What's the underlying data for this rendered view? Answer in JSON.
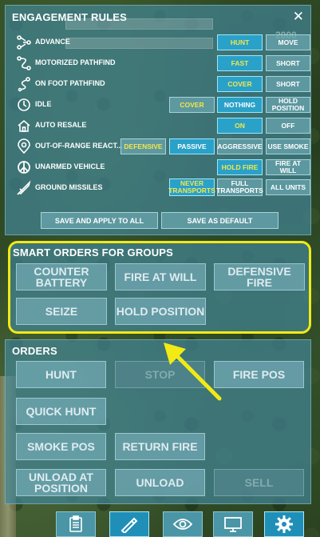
{
  "rules_panel": {
    "title": "ENGAGEMENT RULES",
    "close_glyph": "✕",
    "ghost_value": "2000",
    "rows": [
      {
        "label": "ADVANCE",
        "icon": "advance-icon",
        "options": [
          "HUNT",
          "MOVE"
        ],
        "selected": "HUNT",
        "default": "HUNT"
      },
      {
        "label": "MOTORIZED PATHFIND",
        "icon": "motorized-path-icon",
        "options": [
          "FAST",
          "SHORT"
        ],
        "selected": "FAST",
        "default": "FAST"
      },
      {
        "label": "ON FOOT PATHFIND",
        "icon": "foot-path-icon",
        "options": [
          "COVER",
          "SHORT"
        ],
        "selected": "COVER",
        "default": "COVER"
      },
      {
        "label": "IDLE",
        "icon": "idle-clock-icon",
        "options": [
          "COVER",
          "NOTHING",
          "HOLD POSITION"
        ],
        "selected": "NOTHING",
        "default": "COVER"
      },
      {
        "label": "AUTO RESALE",
        "icon": "house-icon",
        "options": [
          "ON",
          "OFF"
        ],
        "selected": "ON",
        "default": "ON"
      },
      {
        "label": "OUT-OF-RANGE REACT...",
        "icon": "target-pin-icon",
        "options": [
          "DEFENSIVE",
          "PASSIVE",
          "AGGRESSIVE",
          "USE SMOKE"
        ],
        "selected": "PASSIVE",
        "default": "DEFENSIVE"
      },
      {
        "label": "UNARMED VEHICLE",
        "icon": "peace-icon",
        "options": [
          "HOLD FIRE",
          "FIRE AT WILL"
        ],
        "selected": "HOLD FIRE",
        "default": "HOLD FIRE"
      },
      {
        "label": "GROUND MISSILES",
        "icon": "missile-icon",
        "options": [
          "NEVER TRANSPORTS",
          "FULL TRANSPORTS",
          "ALL UNITS"
        ],
        "selected": "NEVER TRANSPORTS",
        "default": "NEVER TRANSPORTS"
      }
    ],
    "save_all_label": "SAVE AND APPLY TO ALL",
    "save_default_label": "SAVE AS DEFAULT"
  },
  "smart_panel": {
    "title": "SMART ORDERS FOR GROUPS",
    "buttons": [
      "COUNTER BATTERY",
      "FIRE AT WILL",
      "DEFENSIVE FIRE",
      "SEIZE",
      "HOLD POSITION"
    ]
  },
  "orders_panel": {
    "title": "ORDERS",
    "buttons": [
      {
        "label": "HUNT",
        "enabled": true
      },
      {
        "label": "STOP",
        "enabled": false
      },
      {
        "label": "FIRE POS",
        "enabled": true
      },
      {
        "label": "QUICK HUNT",
        "enabled": true
      },
      {
        "label": "SMOKE POS",
        "enabled": true
      },
      {
        "label": "RETURN FIRE",
        "enabled": true
      },
      {
        "label": "UNLOAD AT POSITION",
        "enabled": true
      },
      {
        "label": "UNLOAD",
        "enabled": true
      },
      {
        "label": "SELL",
        "enabled": false
      }
    ]
  },
  "toolbar": {
    "items": [
      {
        "icon": "clipboard-icon",
        "active": false
      },
      {
        "icon": "pencil-ruler-icon",
        "active": true
      },
      {
        "icon": "eye-icon",
        "active": false
      },
      {
        "icon": "monitor-icon",
        "active": false
      },
      {
        "icon": "gear-icon",
        "active": false
      }
    ]
  },
  "colors": {
    "panel": "#428494",
    "selected": "#2aa1c9",
    "default_text": "#f4e64a",
    "highlight": "#f1ea14"
  }
}
